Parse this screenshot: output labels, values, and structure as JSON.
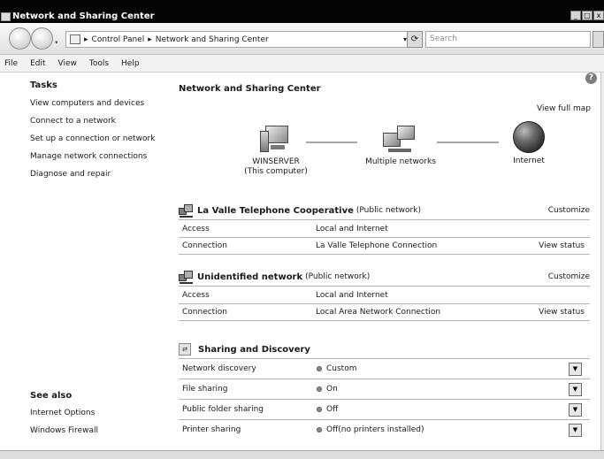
{
  "window": {
    "title": "Network and Sharing Center",
    "controls": [
      "_",
      "□",
      "x"
    ]
  },
  "navbar": {
    "address_parts": [
      "Control Panel",
      "Network and Sharing Center"
    ],
    "address_separator": "▸",
    "search_placeholder": "Search"
  },
  "menu": [
    "File",
    "Edit",
    "View",
    "Tools",
    "Help"
  ],
  "sidebar": {
    "tasks_heading": "Tasks",
    "tasks": [
      "View computers and devices",
      "Connect to a network",
      "Set up a connection or network",
      "Manage network connections",
      "Diagnose and repair"
    ],
    "see_also_heading": "See also",
    "see_also": [
      "Internet Options",
      "Windows Firewall"
    ]
  },
  "main": {
    "title": "Network and Sharing Center",
    "view_full_map": "View full map",
    "map": {
      "computer_name": "WINSERVER",
      "computer_sub": "(This computer)",
      "middle": "Multiple networks",
      "internet": "Internet"
    },
    "networks": [
      {
        "name": "La Valle Telephone Cooperative",
        "type": "(Public network)",
        "customize": "Customize",
        "access_label": "Access",
        "access_value": "Local and Internet",
        "connection_label": "Connection",
        "connection_value": "La Valle Telephone Connection",
        "view_status": "View status"
      },
      {
        "name": "Unidentified network",
        "type": "(Public network)",
        "customize": "Customize",
        "access_label": "Access",
        "access_value": "Local and Internet",
        "connection_label": "Connection",
        "connection_value": "Local Area Network Connection",
        "view_status": "View status"
      }
    ],
    "sharing": {
      "heading": "Sharing and Discovery",
      "rows": [
        {
          "label": "Network discovery",
          "value": "Custom"
        },
        {
          "label": "File sharing",
          "value": "On"
        },
        {
          "label": "Public folder sharing",
          "value": "Off"
        },
        {
          "label": "Printer sharing",
          "value": "Off(no printers installed)"
        }
      ]
    }
  }
}
